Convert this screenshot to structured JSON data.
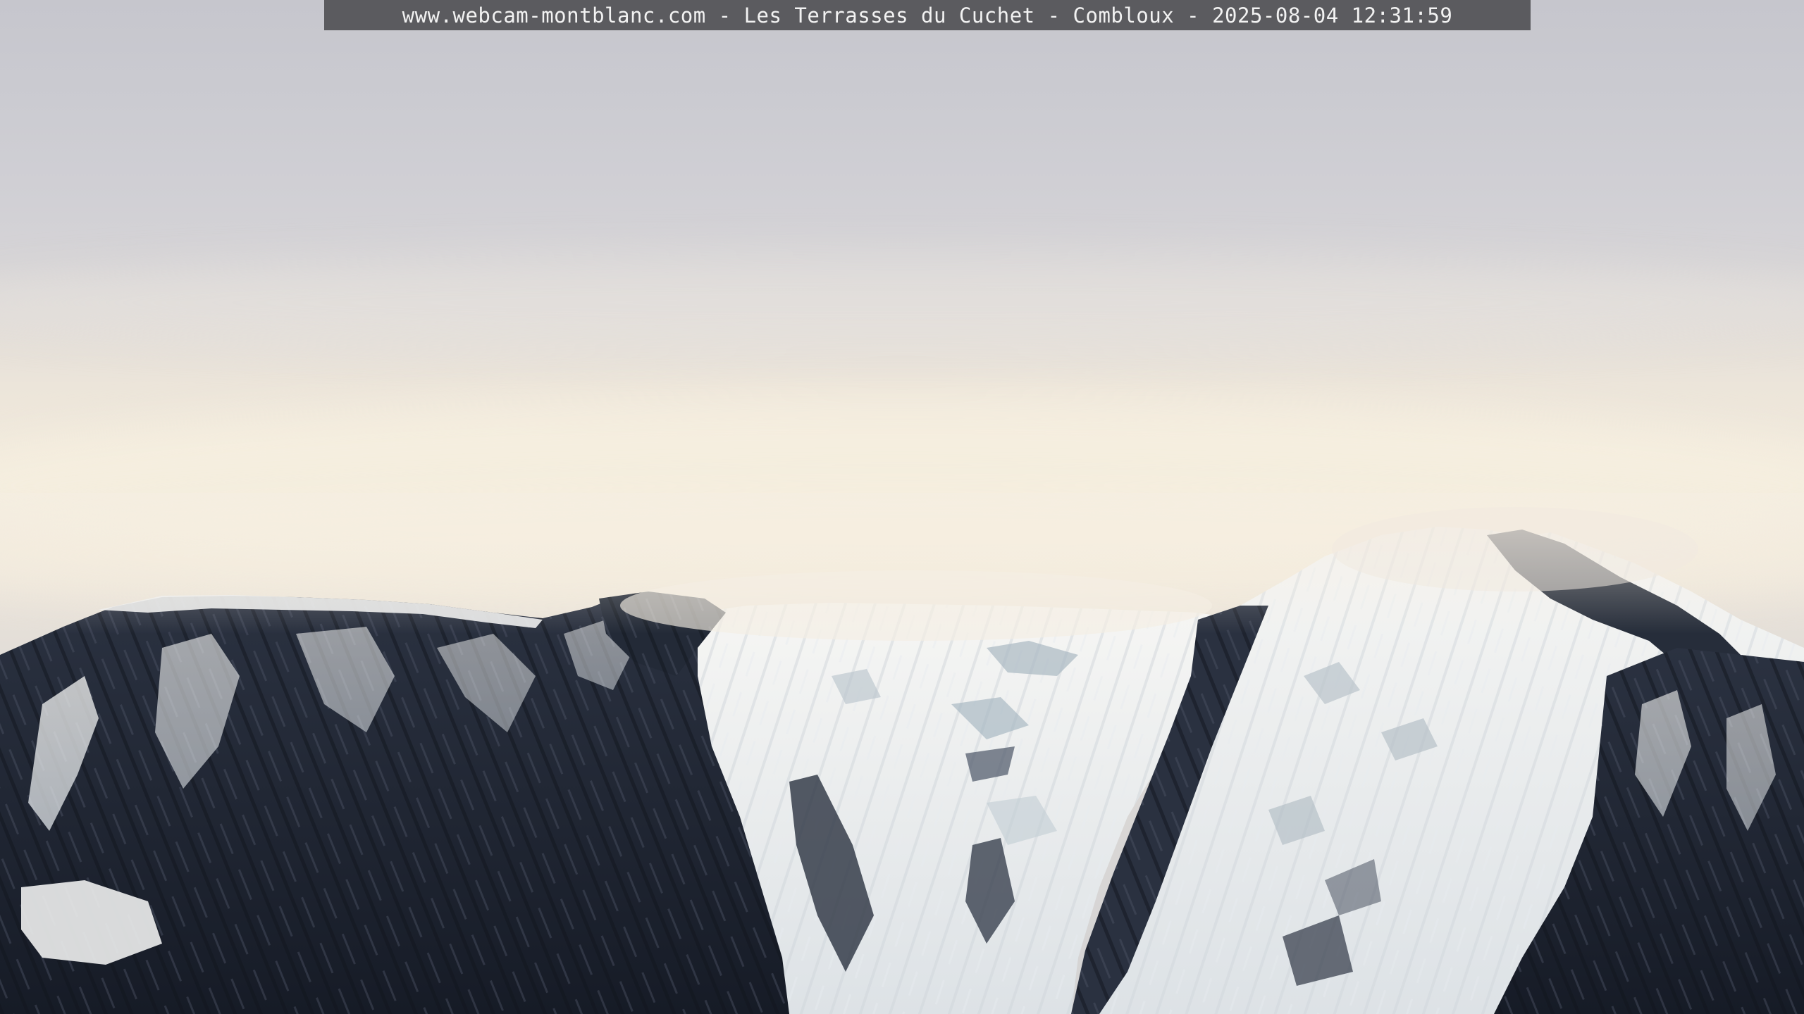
{
  "webcam": {
    "caption": "www.webcam-montblanc.com - Les Terrasses du Cuchet - Combloux - 2025-08-04 12:31:59"
  },
  "colors": {
    "sky_top": "#c6c6cd",
    "cloud_glow": "#f0e9dc",
    "rock_dark": "#1f2533",
    "rock_mid": "#3a4150",
    "snow": "#eef1f3",
    "caption_bg": "#3c3c40",
    "caption_text": "#f2f2f2"
  }
}
